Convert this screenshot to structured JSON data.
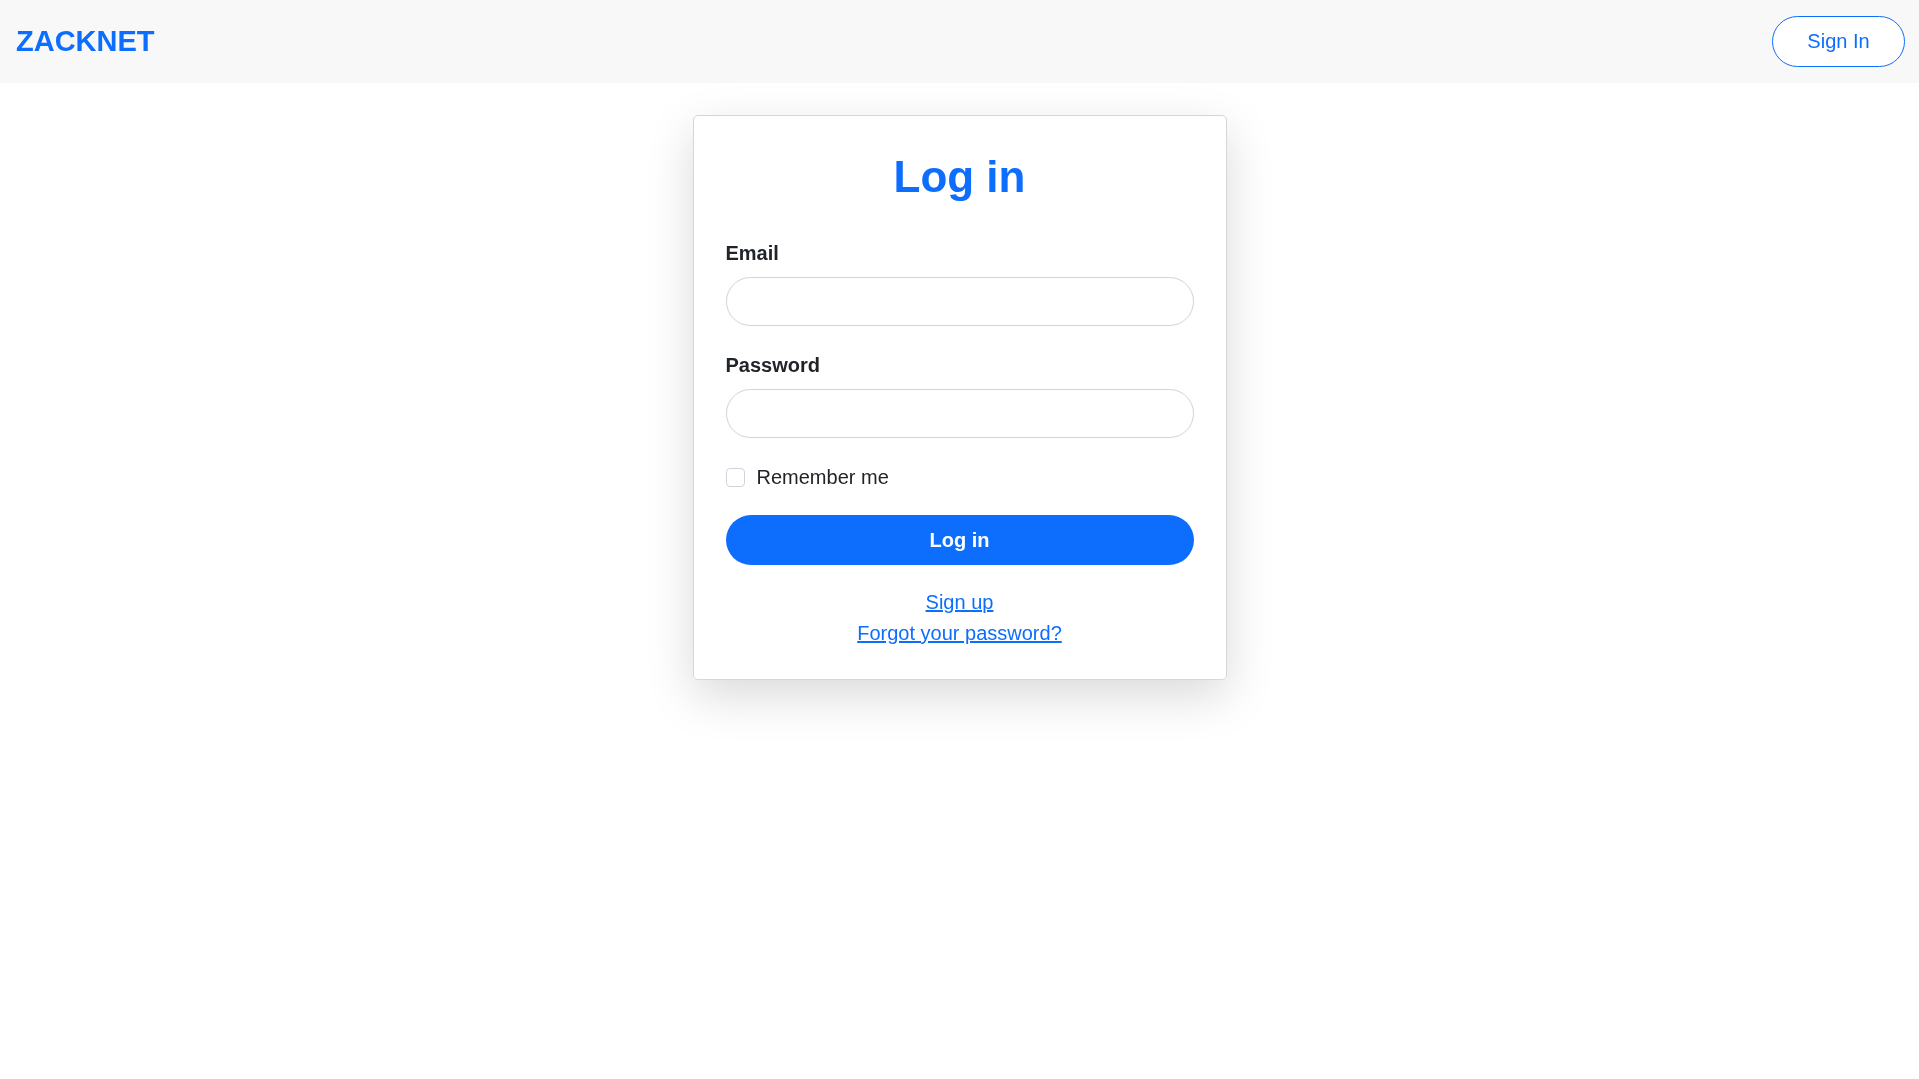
{
  "navbar": {
    "brand": "ZACKNET",
    "sign_in_button": "Sign In"
  },
  "login_card": {
    "title": "Log in",
    "fields": [
      {
        "label": "Email"
      },
      {
        "label": "Password"
      }
    ],
    "remember_me": {
      "label": "Remember me",
      "checked": false
    },
    "submit_button": "Log in",
    "links": [
      "Sign up",
      "Forgot your password?"
    ]
  }
}
